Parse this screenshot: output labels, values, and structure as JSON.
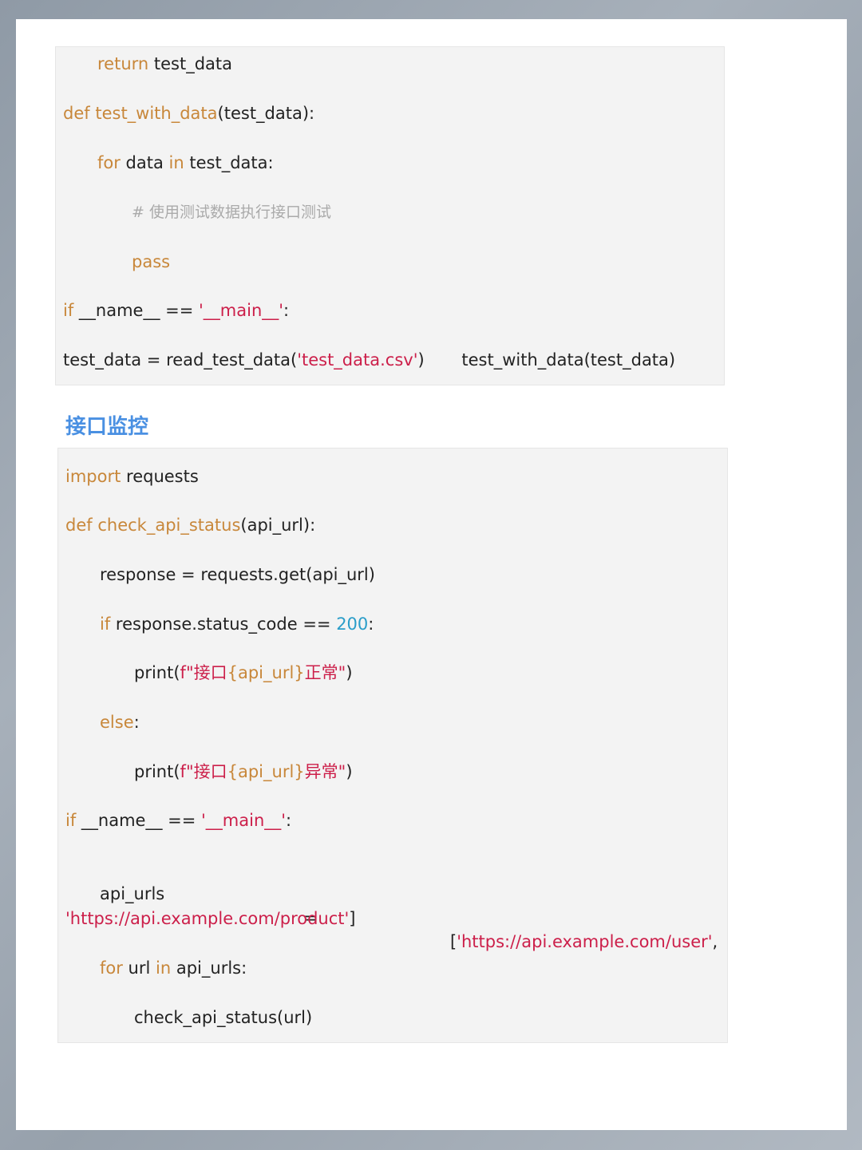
{
  "block1": {
    "l1": {
      "kw": "return",
      "rest": " test_data"
    },
    "l2": {
      "kw": "def",
      "fn": "test_with_data",
      "rest": "(test_data):"
    },
    "l3": {
      "kw1": "for",
      "mid": " data ",
      "kw2": "in",
      "rest": " test_data:"
    },
    "l4": {
      "comment": "# 使用测试数据执行接口测试"
    },
    "l5": {
      "kw": "pass"
    },
    "l6": {
      "kw": "if",
      "mid": " __name__ == ",
      "str": "'__main__'",
      "rest": ":"
    },
    "l7": {
      "a": "test_data = read_test_data(",
      "str": "'test_data.csv'",
      "b": ")",
      "gap": "       ",
      "c": "test_with_data(test_data)"
    }
  },
  "heading": "接口监控",
  "block2": {
    "l1": {
      "kw": "import",
      "rest": " requests"
    },
    "l2": {
      "kw": "def",
      "fn": "check_api_status",
      "rest": "(api_url):"
    },
    "l3": {
      "text": "response = requests.get(api_url)"
    },
    "l4": {
      "kw": "if",
      "mid": " response.status_code == ",
      "num": "200",
      "rest": ":"
    },
    "l5": {
      "a": "print(",
      "str1": "f\"接口",
      "var": "{api_url}",
      "str2": "正常\"",
      "b": ")"
    },
    "l6": {
      "kw": "else",
      "rest": ":"
    },
    "l7": {
      "a": "print(",
      "str1": "f\"接口",
      "var": "{api_url}",
      "str2": "异常\"",
      "b": ")"
    },
    "l8": {
      "kw": "if",
      "mid": " __name__ == ",
      "str": "'__main__'",
      "rest": ":"
    },
    "l9": {
      "a": "api_urls",
      "eq": "=",
      "open": "[",
      "str": "'https://api.example.com/user'",
      "comma": ","
    },
    "l10": {
      "str": "'https://api.example.com/product'",
      "close": "]"
    },
    "l11": {
      "kw1": "for",
      "mid": " url ",
      "kw2": "in",
      "rest": " api_urls:"
    },
    "l12": {
      "text": "check_api_status(url)"
    }
  }
}
